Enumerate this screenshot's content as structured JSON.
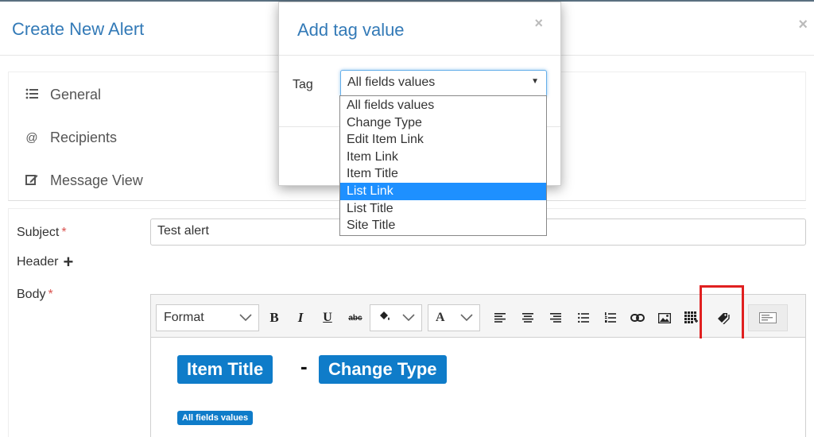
{
  "background_dialog": {
    "title": "Create New Alert",
    "close_glyph": "×",
    "nav": [
      {
        "label": "General",
        "icon": "list-icon"
      },
      {
        "label": "Recipients",
        "icon": "at-icon"
      },
      {
        "label": "Message View",
        "icon": "edit-icon"
      }
    ],
    "form": {
      "subject_label": "Subject",
      "subject_value": "Test alert",
      "required_mark": "*",
      "header_label": "Header",
      "header_add_glyph": "+",
      "body_label": "Body"
    },
    "editor": {
      "toolbar": {
        "format_label": "Format",
        "bold": "B",
        "italic": "I",
        "underline": "U",
        "strike": "abc",
        "font_color": "A",
        "icons": [
          "paint-bucket-icon",
          "align-left-icon",
          "align-center-icon",
          "align-right-icon",
          "bulleted-list-icon",
          "numbered-list-icon",
          "link-icon",
          "image-icon",
          "table-icon",
          "tag-icon",
          "source-icon"
        ]
      },
      "content": {
        "tag_item_title": "Item Title",
        "dash": "-",
        "tag_change_type": "Change Type",
        "tag_all_fields": "All fields values"
      }
    }
  },
  "modal": {
    "title": "Add tag value",
    "close_glyph": "×",
    "tag_label": "Tag",
    "selected_value": "All fields values",
    "options": [
      "All fields values",
      "Change Type",
      "Edit Item Link",
      "Item Link",
      "Item Title",
      "List Link",
      "List Title",
      "Site Title"
    ],
    "highlighted_option": "List Link"
  },
  "colors": {
    "title_blue": "#337ab7",
    "tag_blue": "#0f7cc9",
    "highlight_red": "#e02020",
    "selection_blue": "#1e90ff",
    "required_red": "#d9534f"
  }
}
